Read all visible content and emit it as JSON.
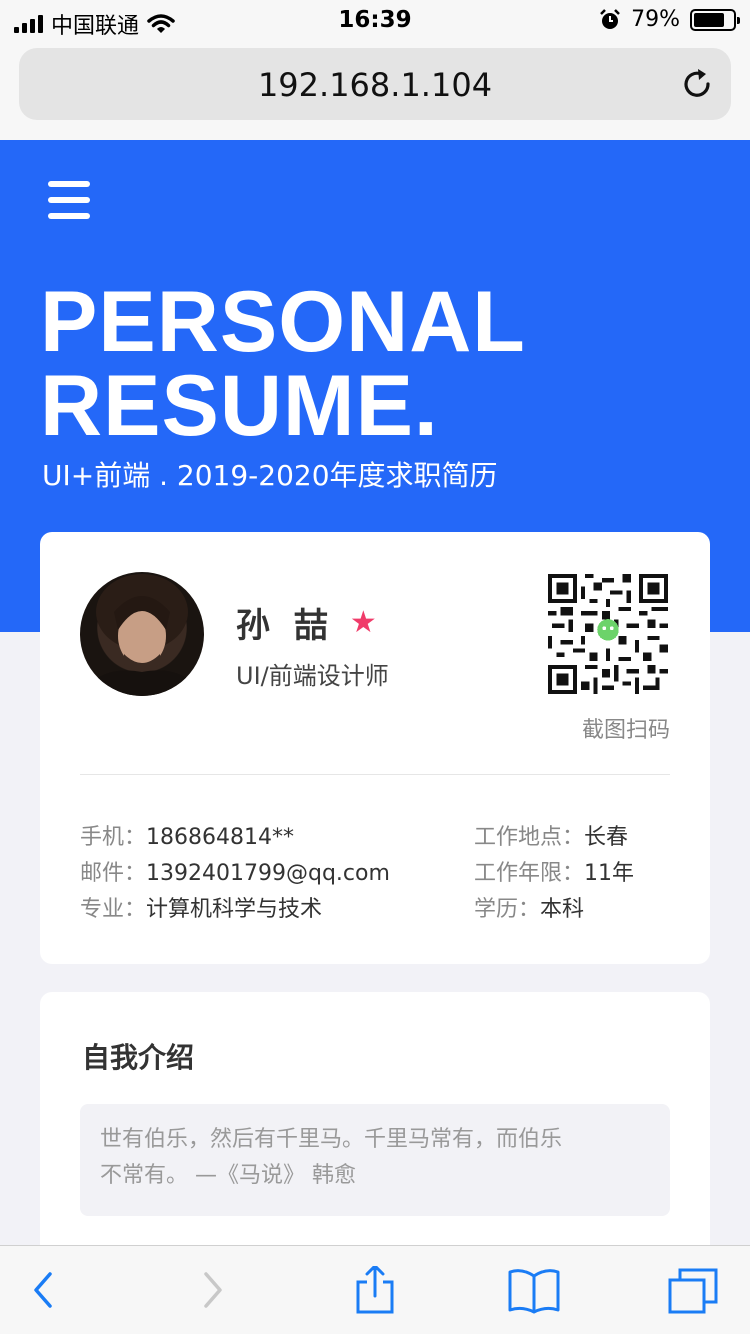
{
  "status": {
    "carrier": "中国联通",
    "time": "16:39",
    "battery": "79%",
    "battery_level": 0.79
  },
  "browser": {
    "url": "192.168.1.104"
  },
  "hero": {
    "title_line1": "PERSONAL",
    "title_line2": "RESUME.",
    "subtitle": "UI+前端 . 2019-2020年度求职简历"
  },
  "profile": {
    "name": "孙 喆",
    "role": "UI/前端设计师",
    "qr_label": "截图扫码",
    "info_left": [
      {
        "key": "手机：",
        "value": "186864814**"
      },
      {
        "key": "邮件：",
        "value": "1392401799@qq.com"
      },
      {
        "key": "专业：",
        "value": "计算机科学与技术"
      }
    ],
    "info_right": [
      {
        "key": "工作地点：",
        "value": "长春"
      },
      {
        "key": "工作年限：",
        "value": "11年"
      },
      {
        "key": "学历：",
        "value": "本科"
      }
    ]
  },
  "intro": {
    "title": "自我介绍",
    "line1": "世有伯乐，然后有千里马。千里马常有，而伯乐",
    "line2": "不常有。 —《马说》 韩愈"
  },
  "colors": {
    "accent": "#2468f8",
    "star": "#f03c6a",
    "toolbar_icon": "#1a7cf5"
  }
}
